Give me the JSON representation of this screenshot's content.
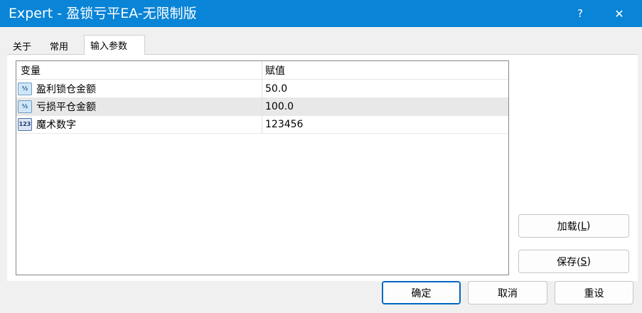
{
  "window": {
    "title": "Expert - 盈锁亏平EA-无限制版",
    "help_label": "?",
    "close_label": "✕"
  },
  "tabs": [
    {
      "label": "关于"
    },
    {
      "label": "常用"
    },
    {
      "label": "输入参数",
      "active": true
    }
  ],
  "grid": {
    "headers": {
      "name": "变量",
      "value": "赋值"
    },
    "rows": [
      {
        "icon": "double-type-icon",
        "icon_text": "½",
        "name": "盈利锁仓金额",
        "value": "50.0"
      },
      {
        "icon": "double-type-icon",
        "icon_text": "½",
        "name": "亏损平仓金额",
        "value": "100.0",
        "selected": true
      },
      {
        "icon": "integer-type-icon",
        "icon_text": "123",
        "name": "魔术数字",
        "value": "123456"
      }
    ]
  },
  "side_buttons": {
    "load_label": "加载(",
    "load_key": "L",
    "load_suffix": ")",
    "save_label": "保存(",
    "save_key": "S",
    "save_suffix": ")"
  },
  "footer": {
    "ok_label": "确定",
    "cancel_label": "取消",
    "reset_label": "重设"
  },
  "colors": {
    "titlebar": "#0a84d6",
    "selected_row": "#e8e8e8",
    "default_button_border": "#0067c0"
  }
}
